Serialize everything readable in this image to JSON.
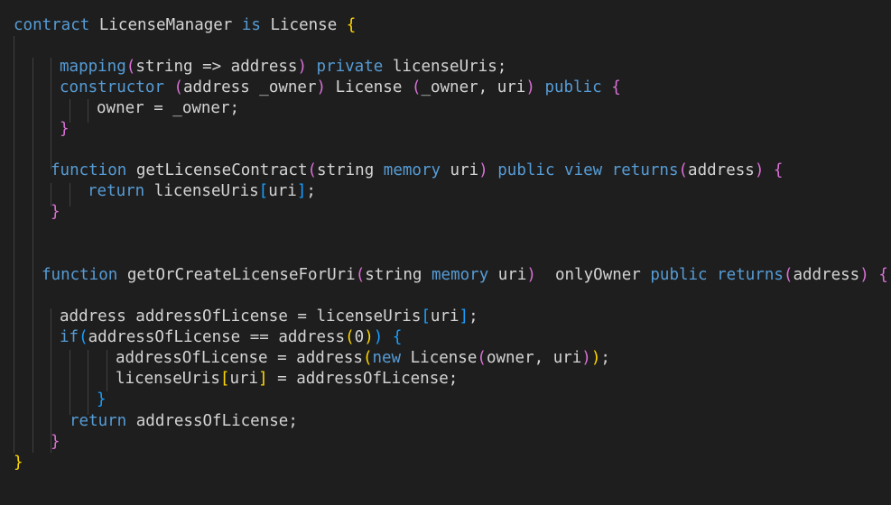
{
  "editor": {
    "language": "solidity",
    "theme": {
      "background": "#1e1e1e",
      "keyword": "#569cd6",
      "text": "#d4d4d4",
      "bracket_gold": "#ffd700",
      "bracket_purple": "#da70d6",
      "bracket_blue": "#179fff",
      "indent_guide": "#404040"
    },
    "lines": [
      {
        "tokens": [
          {
            "t": "contract",
            "c": "kw"
          },
          {
            "t": " LicenseManager ",
            "c": "tx"
          },
          {
            "t": "is",
            "c": "kw"
          },
          {
            "t": " License ",
            "c": "tx"
          },
          {
            "t": "{",
            "c": "b1"
          }
        ]
      },
      {
        "tokens": []
      },
      {
        "tokens": [
          {
            "t": "mapping",
            "c": "kw"
          },
          {
            "t": "(",
            "c": "b2"
          },
          {
            "t": "string => address",
            "c": "tx"
          },
          {
            "t": ")",
            "c": "b2"
          },
          {
            "t": " ",
            "c": "tx"
          },
          {
            "t": "private",
            "c": "kw"
          },
          {
            "t": " licenseUris;",
            "c": "tx"
          }
        ]
      },
      {
        "tokens": [
          {
            "t": "constructor",
            "c": "kw"
          },
          {
            "t": " ",
            "c": "tx"
          },
          {
            "t": "(",
            "c": "b2"
          },
          {
            "t": "address _owner",
            "c": "tx"
          },
          {
            "t": ")",
            "c": "b2"
          },
          {
            "t": " License ",
            "c": "tx"
          },
          {
            "t": "(",
            "c": "b2"
          },
          {
            "t": "_owner, uri",
            "c": "tx"
          },
          {
            "t": ")",
            "c": "b2"
          },
          {
            "t": " ",
            "c": "tx"
          },
          {
            "t": "public",
            "c": "kw"
          },
          {
            "t": " ",
            "c": "tx"
          },
          {
            "t": "{",
            "c": "b2"
          }
        ]
      },
      {
        "tokens": [
          {
            "t": "owner = _owner;",
            "c": "tx"
          }
        ]
      },
      {
        "tokens": [
          {
            "t": "}",
            "c": "b2"
          }
        ]
      },
      {
        "tokens": []
      },
      {
        "tokens": [
          {
            "t": "function",
            "c": "kw"
          },
          {
            "t": " getLicenseContract",
            "c": "tx"
          },
          {
            "t": "(",
            "c": "b2"
          },
          {
            "t": "string ",
            "c": "tx"
          },
          {
            "t": "memory",
            "c": "kw"
          },
          {
            "t": " uri",
            "c": "tx"
          },
          {
            "t": ")",
            "c": "b2"
          },
          {
            "t": " ",
            "c": "tx"
          },
          {
            "t": "public",
            "c": "kw"
          },
          {
            "t": " ",
            "c": "tx"
          },
          {
            "t": "view",
            "c": "kw"
          },
          {
            "t": " ",
            "c": "tx"
          },
          {
            "t": "returns",
            "c": "kw"
          },
          {
            "t": "(",
            "c": "b2"
          },
          {
            "t": "address",
            "c": "tx"
          },
          {
            "t": ")",
            "c": "b2"
          },
          {
            "t": " ",
            "c": "tx"
          },
          {
            "t": "{",
            "c": "b2"
          }
        ]
      },
      {
        "tokens": [
          {
            "t": "return",
            "c": "kw"
          },
          {
            "t": " licenseUris",
            "c": "tx"
          },
          {
            "t": "[",
            "c": "b3"
          },
          {
            "t": "uri",
            "c": "tx"
          },
          {
            "t": "]",
            "c": "b3"
          },
          {
            "t": ";",
            "c": "tx"
          }
        ]
      },
      {
        "tokens": [
          {
            "t": "}",
            "c": "b2"
          }
        ]
      },
      {
        "tokens": []
      },
      {
        "tokens": []
      },
      {
        "tokens": [
          {
            "t": "function",
            "c": "kw"
          },
          {
            "t": " getOrCreateLicenseForUri",
            "c": "tx"
          },
          {
            "t": "(",
            "c": "b2"
          },
          {
            "t": "string ",
            "c": "tx"
          },
          {
            "t": "memory",
            "c": "kw"
          },
          {
            "t": " uri",
            "c": "tx"
          },
          {
            "t": ")",
            "c": "b2"
          },
          {
            "t": "  onlyOwner ",
            "c": "tx"
          },
          {
            "t": "public",
            "c": "kw"
          },
          {
            "t": " ",
            "c": "tx"
          },
          {
            "t": "returns",
            "c": "kw"
          },
          {
            "t": "(",
            "c": "b2"
          },
          {
            "t": "address",
            "c": "tx"
          },
          {
            "t": ")",
            "c": "b2"
          },
          {
            "t": " ",
            "c": "tx"
          },
          {
            "t": "{",
            "c": "b2"
          }
        ]
      },
      {
        "tokens": []
      },
      {
        "tokens": [
          {
            "t": "address addressOfLicense = licenseUris",
            "c": "tx"
          },
          {
            "t": "[",
            "c": "b3"
          },
          {
            "t": "uri",
            "c": "tx"
          },
          {
            "t": "]",
            "c": "b3"
          },
          {
            "t": ";",
            "c": "tx"
          }
        ]
      },
      {
        "tokens": [
          {
            "t": "if",
            "c": "kw"
          },
          {
            "t": "(",
            "c": "b3"
          },
          {
            "t": "addressOfLicense == address",
            "c": "tx"
          },
          {
            "t": "(",
            "c": "b1"
          },
          {
            "t": "0",
            "c": "tx"
          },
          {
            "t": ")",
            "c": "b1"
          },
          {
            "t": ")",
            "c": "b3"
          },
          {
            "t": " ",
            "c": "tx"
          },
          {
            "t": "{",
            "c": "b3"
          }
        ]
      },
      {
        "tokens": [
          {
            "t": "addressOfLicense = address",
            "c": "tx"
          },
          {
            "t": "(",
            "c": "b1"
          },
          {
            "t": "new",
            "c": "kw"
          },
          {
            "t": " License",
            "c": "tx"
          },
          {
            "t": "(",
            "c": "b2"
          },
          {
            "t": "owner, uri",
            "c": "tx"
          },
          {
            "t": ")",
            "c": "b2"
          },
          {
            "t": ")",
            "c": "b1"
          },
          {
            "t": ";",
            "c": "tx"
          }
        ]
      },
      {
        "tokens": [
          {
            "t": "licenseUris",
            "c": "tx"
          },
          {
            "t": "[",
            "c": "b1"
          },
          {
            "t": "uri",
            "c": "tx"
          },
          {
            "t": "]",
            "c": "b1"
          },
          {
            "t": " = addressOfLicense;",
            "c": "tx"
          }
        ]
      },
      {
        "tokens": [
          {
            "t": "}",
            "c": "b3"
          }
        ]
      },
      {
        "tokens": [
          {
            "t": "return",
            "c": "kw"
          },
          {
            "t": " addressOfLicense;",
            "c": "tx"
          }
        ]
      },
      {
        "tokens": [
          {
            "t": "}",
            "c": "b2"
          }
        ]
      },
      {
        "tokens": [
          {
            "t": "}",
            "c": "b1"
          }
        ]
      }
    ]
  }
}
